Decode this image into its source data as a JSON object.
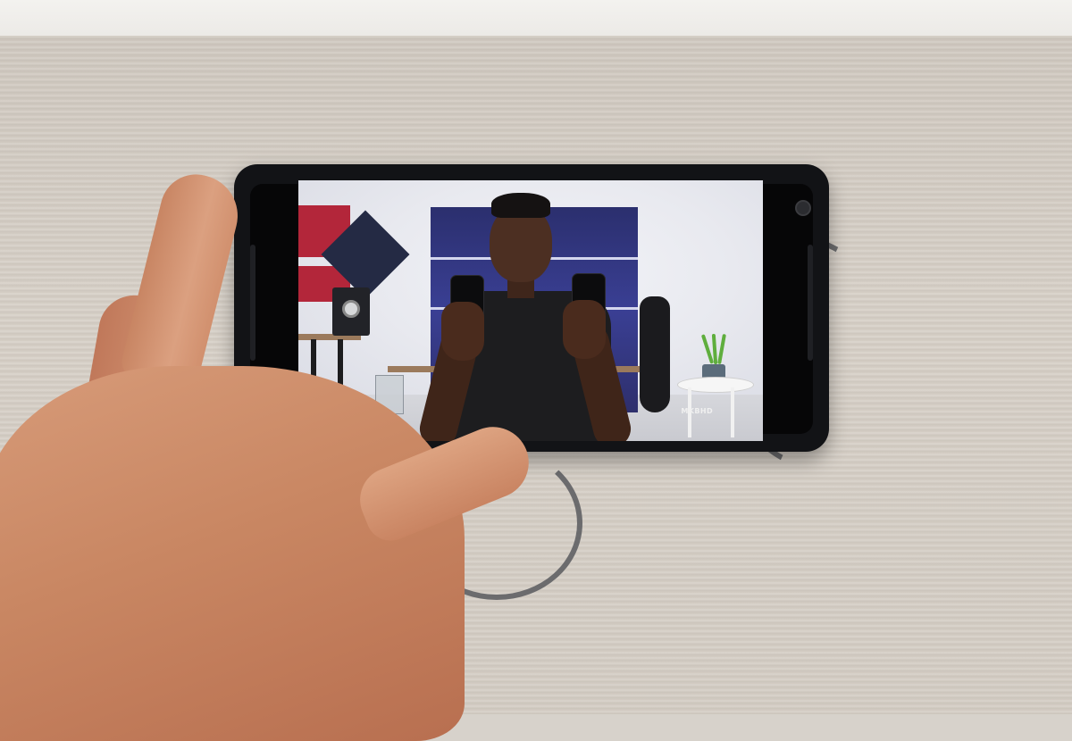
{
  "scene": {
    "description_elements": {
      "video_watermark": "MKBHD"
    },
    "colors": {
      "table": "#d3ccc3",
      "phone_body": "#121316",
      "skin": "#d79b79",
      "blue_panel": "#3a3f94",
      "acoustic_red": "#b3263a"
    }
  }
}
